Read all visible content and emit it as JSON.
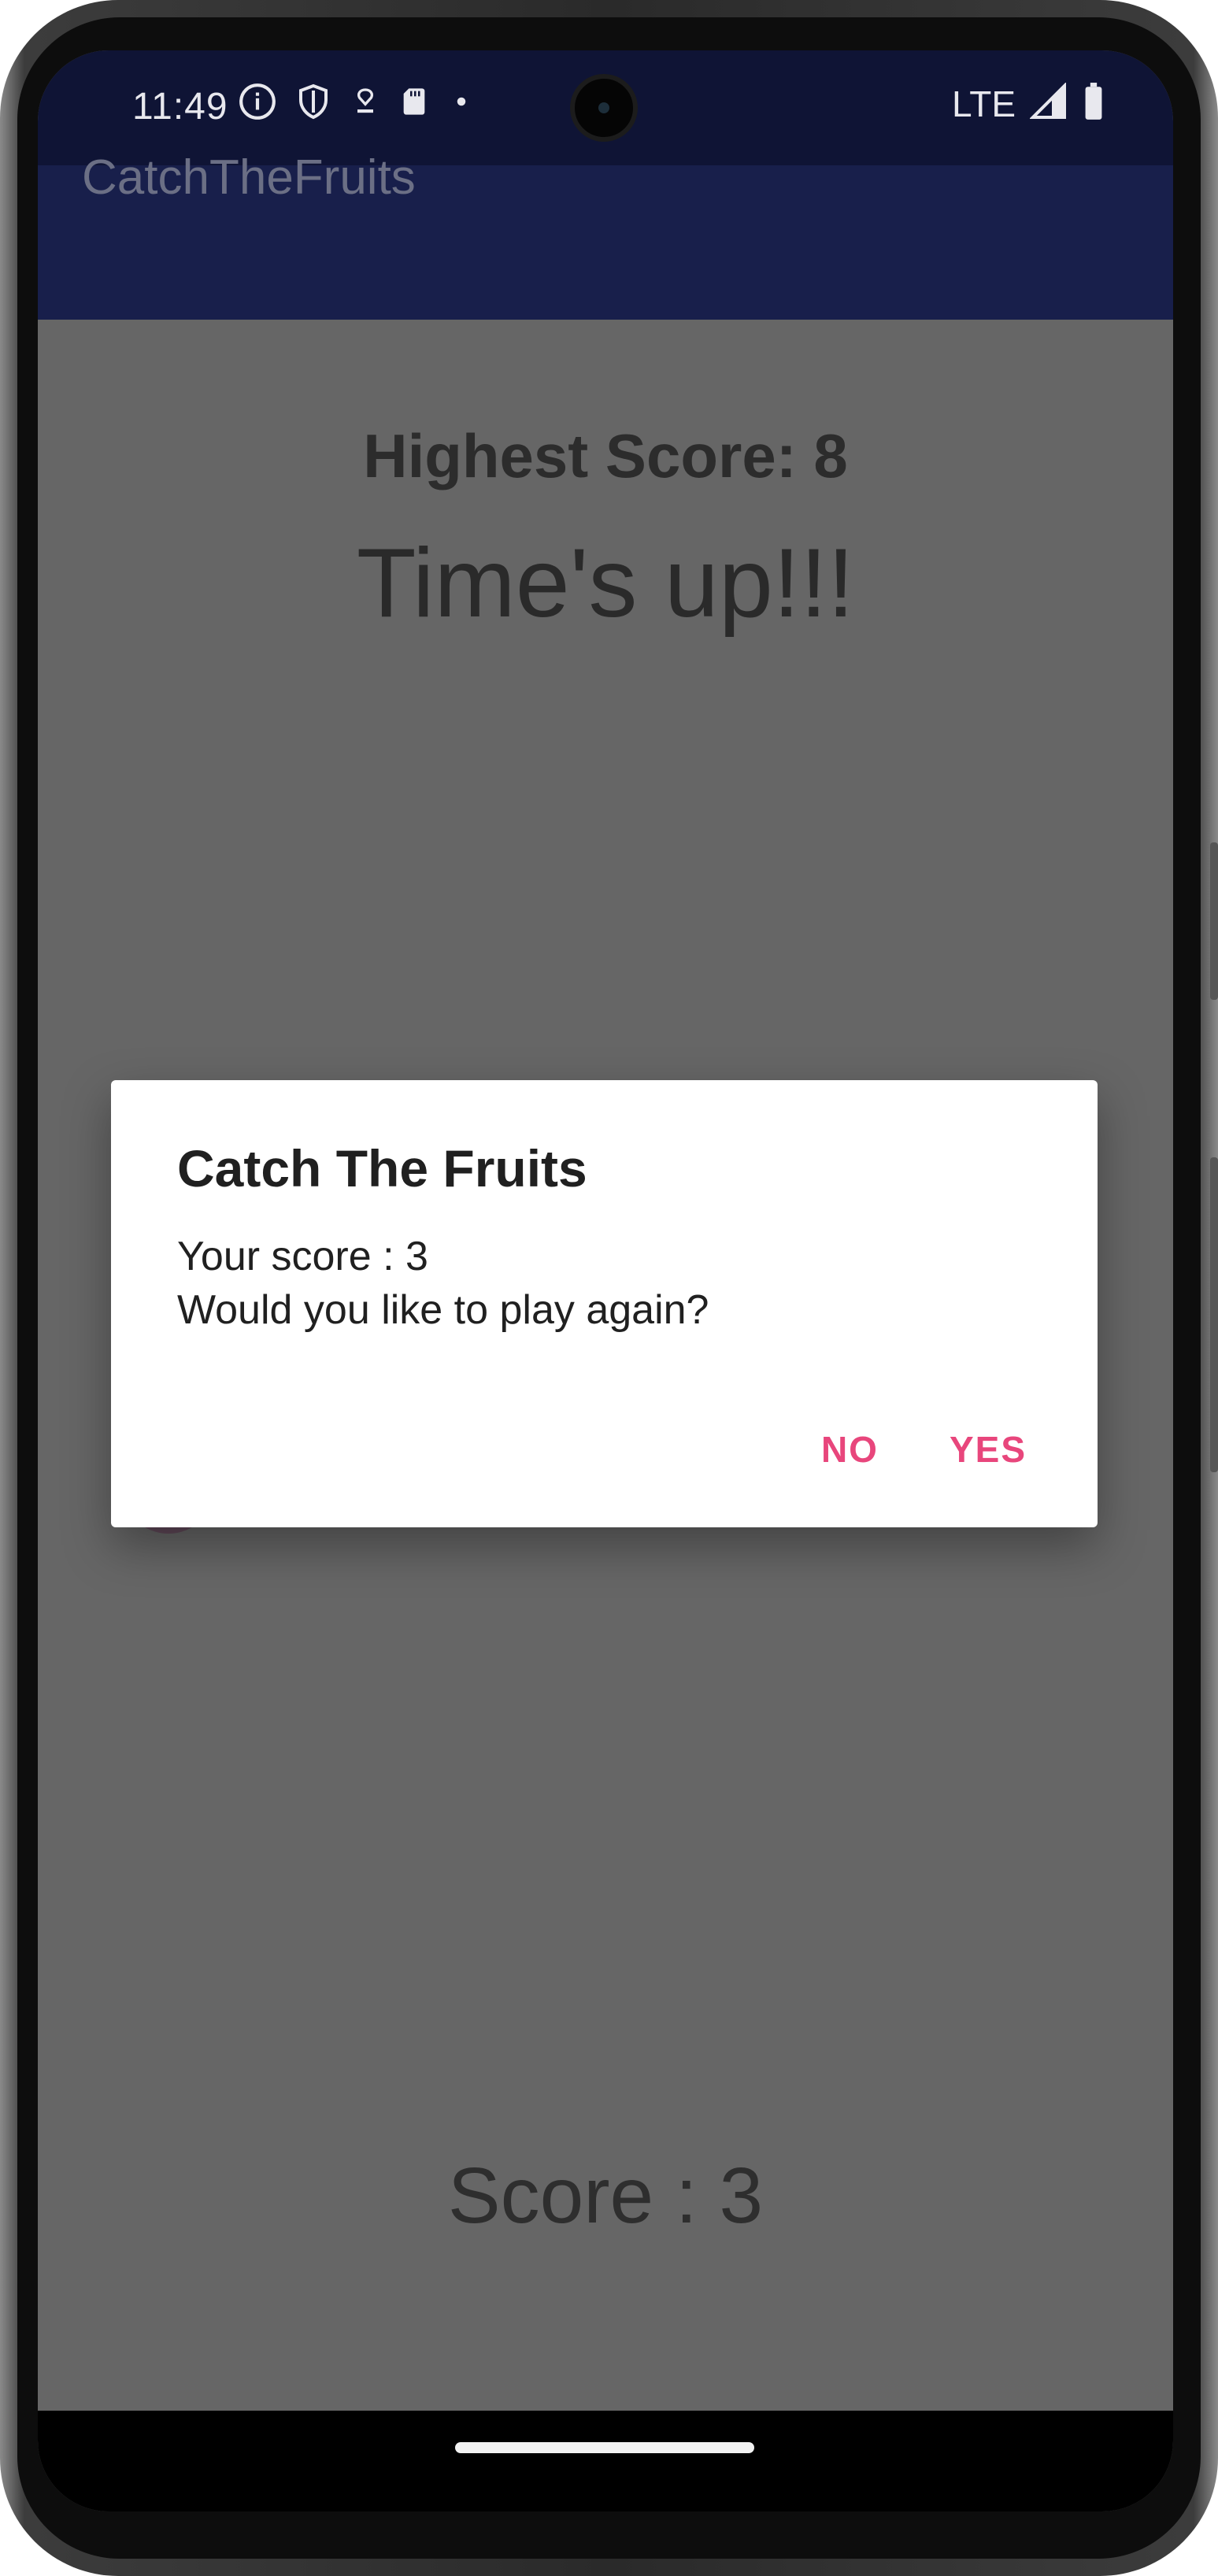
{
  "status_bar": {
    "time": "11:49",
    "network": "LTE",
    "icons": [
      "info-icon",
      "shield-icon",
      "location-icon",
      "sd-card-icon",
      "dot-icon",
      "signal-icon",
      "battery-icon"
    ]
  },
  "app_bar": {
    "title": "CatchTheFruits"
  },
  "game": {
    "highest_score": "Highest Score: 8",
    "times_up": "Time's up!!!",
    "score": "Score : 3"
  },
  "dialog": {
    "title": "Catch The Fruits",
    "message_line1": "Your score : 3",
    "message_line2": "Would you like to play again?",
    "no_label": "NO",
    "yes_label": "YES",
    "accent_color": "#e8467c"
  },
  "colors": {
    "status_bar": "#0f1435",
    "app_bar": "#181f4b",
    "dimmed_background": "#666666"
  }
}
